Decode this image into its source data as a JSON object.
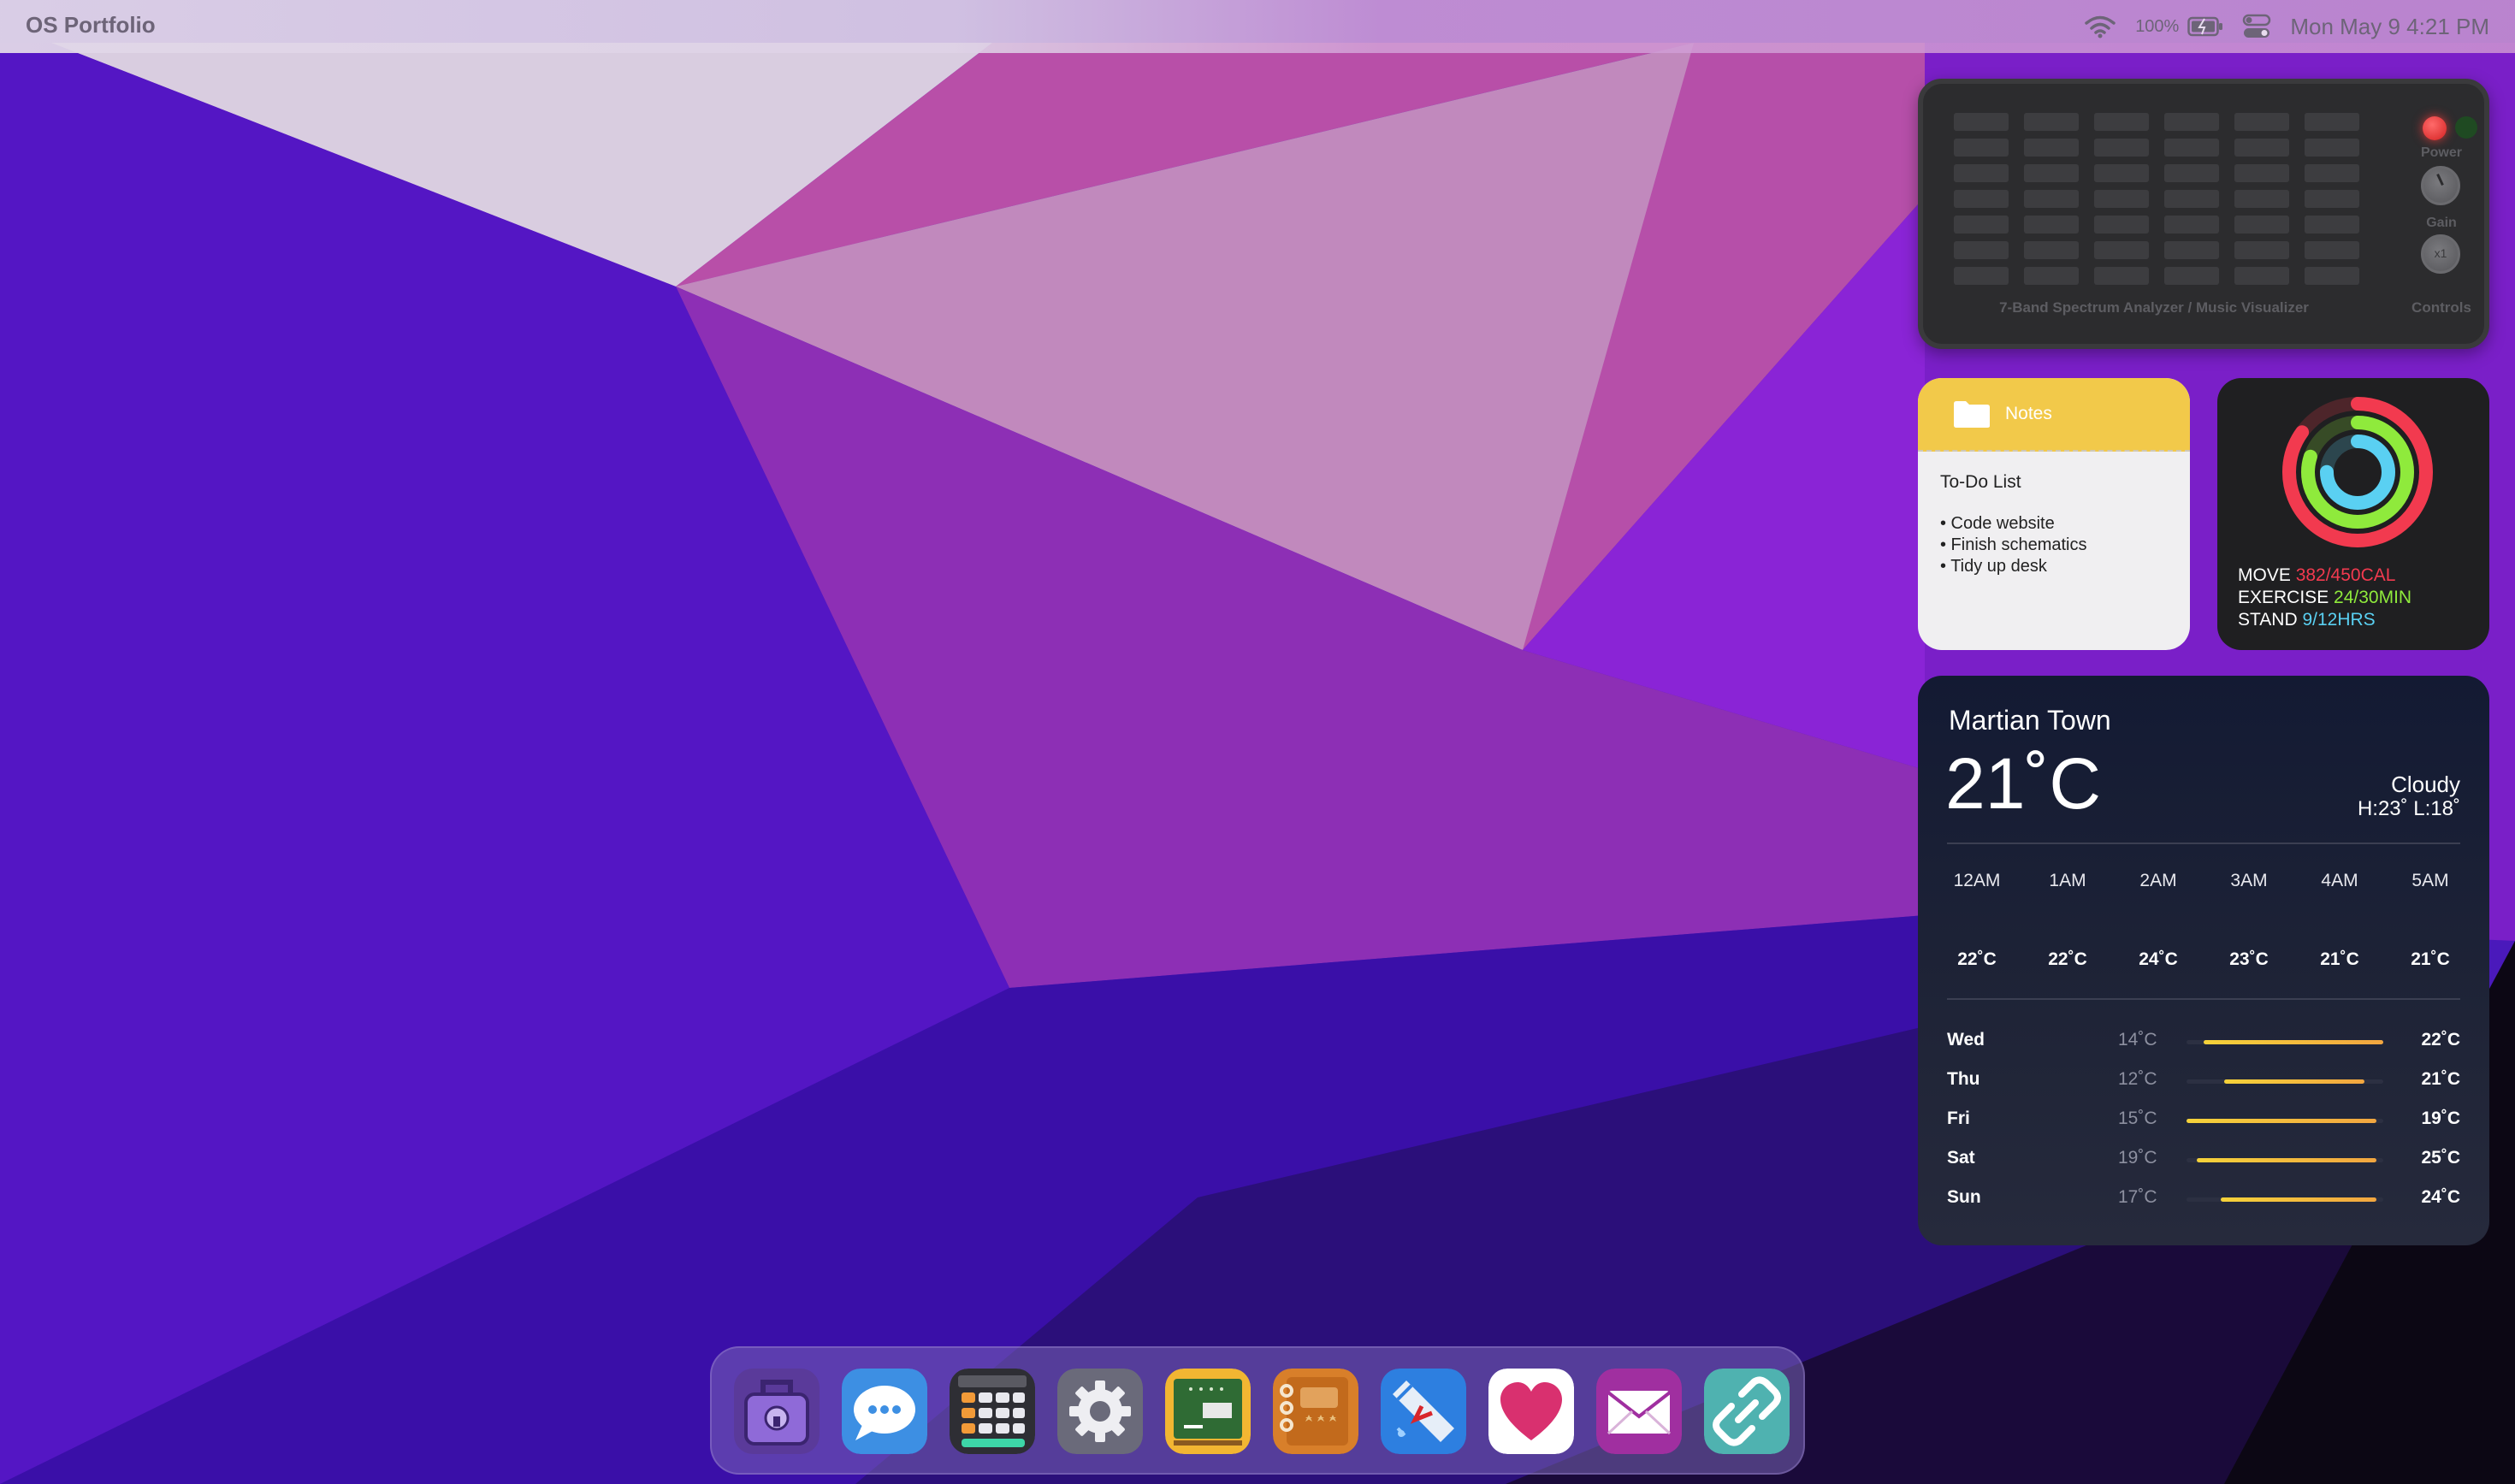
{
  "menubar": {
    "app_title": "OS Portfolio",
    "battery_percent": "100%",
    "clock": "Mon May 9 4:21 PM",
    "icons": [
      "wifi-icon",
      "battery-icon",
      "control-center-icon"
    ]
  },
  "spectrum": {
    "caption": "7-Band Spectrum Analyzer / Music Visualizer",
    "controls_caption": "Controls",
    "power_label": "Power",
    "gain_label": "Gain",
    "multiplier_label": "x1"
  },
  "notes": {
    "header_label": "Notes",
    "title": "To-Do List",
    "items": [
      "• Code website",
      "• Finish schematics",
      "• Tidy up desk"
    ]
  },
  "activity": {
    "move_label": "MOVE",
    "move_value": "382/450CAL",
    "exercise_label": "EXERCISE",
    "exercise_value": "24/30MIN",
    "stand_label": "STAND",
    "stand_value": "9/12HRS",
    "move_progress": 0.849,
    "exercise_progress": 0.8,
    "stand_progress": 0.75,
    "colors": {
      "move": "#f23a4f",
      "exercise": "#8fea3c",
      "stand": "#5ad0f2"
    }
  },
  "weather": {
    "city": "Martian Town",
    "temperature": "21˚C",
    "condition": "Cloudy",
    "high_low": "H:23˚ L:18˚",
    "hourly": [
      {
        "time": "12AM",
        "temp": "22˚C"
      },
      {
        "time": "1AM",
        "temp": "22˚C"
      },
      {
        "time": "2AM",
        "temp": "24˚C"
      },
      {
        "time": "3AM",
        "temp": "23˚C"
      },
      {
        "time": "4AM",
        "temp": "21˚C"
      },
      {
        "time": "5AM",
        "temp": "21˚C"
      }
    ],
    "daily": [
      {
        "day": "Wed",
        "low": "14˚C",
        "high": "22˚C"
      },
      {
        "day": "Thu",
        "low": "12˚C",
        "high": "21˚C"
      },
      {
        "day": "Fri",
        "low": "15˚C",
        "high": "19˚C"
      },
      {
        "day": "Sat",
        "low": "19˚C",
        "high": "25˚C"
      },
      {
        "day": "Sun",
        "low": "17˚C",
        "high": "24˚C"
      }
    ]
  },
  "dock": {
    "apps": [
      "lock-case-icon",
      "messages-icon",
      "calculator-icon",
      "settings-gear-icon",
      "chalkboard-icon",
      "notebook-icon",
      "blueprint-icon",
      "health-heart-icon",
      "mail-icon",
      "link-icon"
    ]
  }
}
